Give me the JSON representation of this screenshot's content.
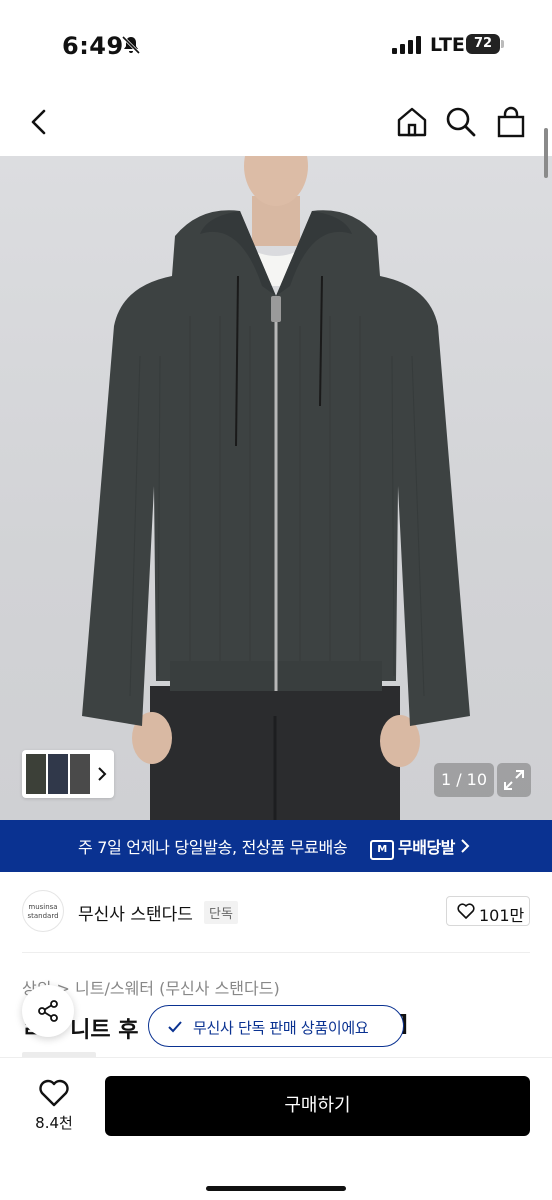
{
  "status_bar": {
    "time": "6:49",
    "network": "LTE",
    "battery": "72"
  },
  "nav": {
    "back_icon": "chevron-left-icon",
    "home_icon": "home-icon",
    "search_icon": "search-icon",
    "cart_icon": "shopping-bag-icon"
  },
  "gallery": {
    "page_counter": "1 / 10",
    "expand_icon": "expand-icon",
    "thumbnail_colors": [
      "#3c4038",
      "#30384a",
      "#4a4a4a"
    ]
  },
  "promo_banner": {
    "text": "주 7일 언제나 당일발송, 전상품 무료배송",
    "badge_mark": "M",
    "badge_label": "무배당발"
  },
  "brand": {
    "logo_line1": "musinsa",
    "logo_line2": "standard",
    "name": "무신사 스탠다드",
    "tag": "단독",
    "like_count": "101만"
  },
  "breadcrumb": "상의 > 니트/스웨터 (무신사 스탠다드)",
  "product_title_partial": "ㄹㅡ 니트 후",
  "product_title_end": "]",
  "toast": {
    "text": "무신사 단독 판매 상품이에요"
  },
  "bottom_bar": {
    "wish_count": "8.4천",
    "buy_label": "구매하기"
  },
  "colors": {
    "accent": "#0a3291",
    "buy_button": "#000000",
    "hero_background": "#d6d7da",
    "sweater": "#3d4242"
  }
}
